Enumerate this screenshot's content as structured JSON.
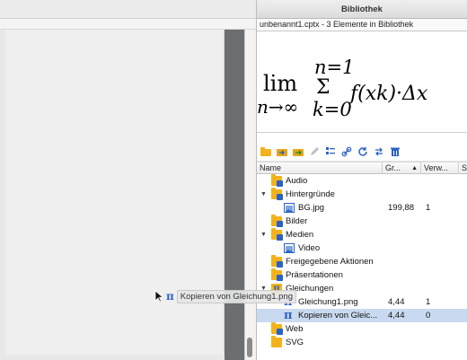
{
  "library": {
    "title": "Bibliothek",
    "subtitle": "unbenannt1.cptx - 3 Elemente in Bibliothek",
    "preview_formula": {
      "lim": "lim",
      "lim_sub": "n→∞",
      "sum_top": "n=1",
      "sum_sym": "Σ",
      "sum_bottom": "k=0",
      "body": "f(xk)·Δx"
    },
    "toolbar_icons": [
      "folder-open-icon",
      "import-icon",
      "export-icon",
      "edit-icon",
      "properties-icon",
      "link-icon",
      "refresh-icon",
      "swap-icon",
      "delete-icon"
    ],
    "columns": {
      "name": "Name",
      "size": "Gr...",
      "sort_indicator": "▲",
      "usage": "Verw...",
      "extra": "S"
    },
    "tree": [
      {
        "label": "Audio",
        "level": 1,
        "icon": "audio-folder-icon",
        "expanded": null,
        "size": "",
        "usage": ""
      },
      {
        "label": "Hintergründe",
        "level": 0,
        "icon": "background-folder-icon",
        "expanded": true,
        "size": "",
        "usage": ""
      },
      {
        "label": "BG.jpg",
        "level": 2,
        "icon": "image-file-icon",
        "expanded": null,
        "size": "199,88",
        "usage": "1"
      },
      {
        "label": "Bilder",
        "level": 1,
        "icon": "images-folder-icon",
        "expanded": null,
        "size": "",
        "usage": ""
      },
      {
        "label": "Medien",
        "level": 0,
        "icon": "media-folder-icon",
        "expanded": true,
        "size": "",
        "usage": ""
      },
      {
        "label": "Video",
        "level": 2,
        "icon": "video-folder-icon",
        "expanded": null,
        "size": "",
        "usage": ""
      },
      {
        "label": "Freigegebene Aktionen",
        "level": 1,
        "icon": "shared-actions-folder-icon",
        "expanded": null,
        "size": "",
        "usage": ""
      },
      {
        "label": "Präsentationen",
        "level": 1,
        "icon": "presentations-folder-icon",
        "expanded": null,
        "size": "",
        "usage": ""
      },
      {
        "label": "Gleichungen",
        "level": 0,
        "icon": "equations-folder-icon",
        "expanded": true,
        "size": "",
        "usage": ""
      },
      {
        "label": "Gleichung1.png",
        "level": 2,
        "icon": "equation-icon",
        "expanded": null,
        "size": "4,44",
        "usage": "1"
      },
      {
        "label": "Kopieren von Gleic...",
        "level": 2,
        "icon": "equation-icon",
        "expanded": null,
        "size": "4,44",
        "usage": "0",
        "selected": true
      },
      {
        "label": "Web",
        "level": 1,
        "icon": "web-folder-icon",
        "expanded": null,
        "size": "",
        "usage": ""
      },
      {
        "label": "SVG",
        "level": 1,
        "icon": "svg-folder-icon",
        "expanded": null,
        "size": "",
        "usage": ""
      }
    ]
  },
  "drag_ghost": {
    "label": "Kopieren von Gleichung1.png",
    "icon": "equation-icon"
  },
  "colors": {
    "selection": "#c9d9ef",
    "folder": "#f3b21c",
    "accent_blue": "#2a62c4",
    "gutter": "#6c6f72"
  }
}
